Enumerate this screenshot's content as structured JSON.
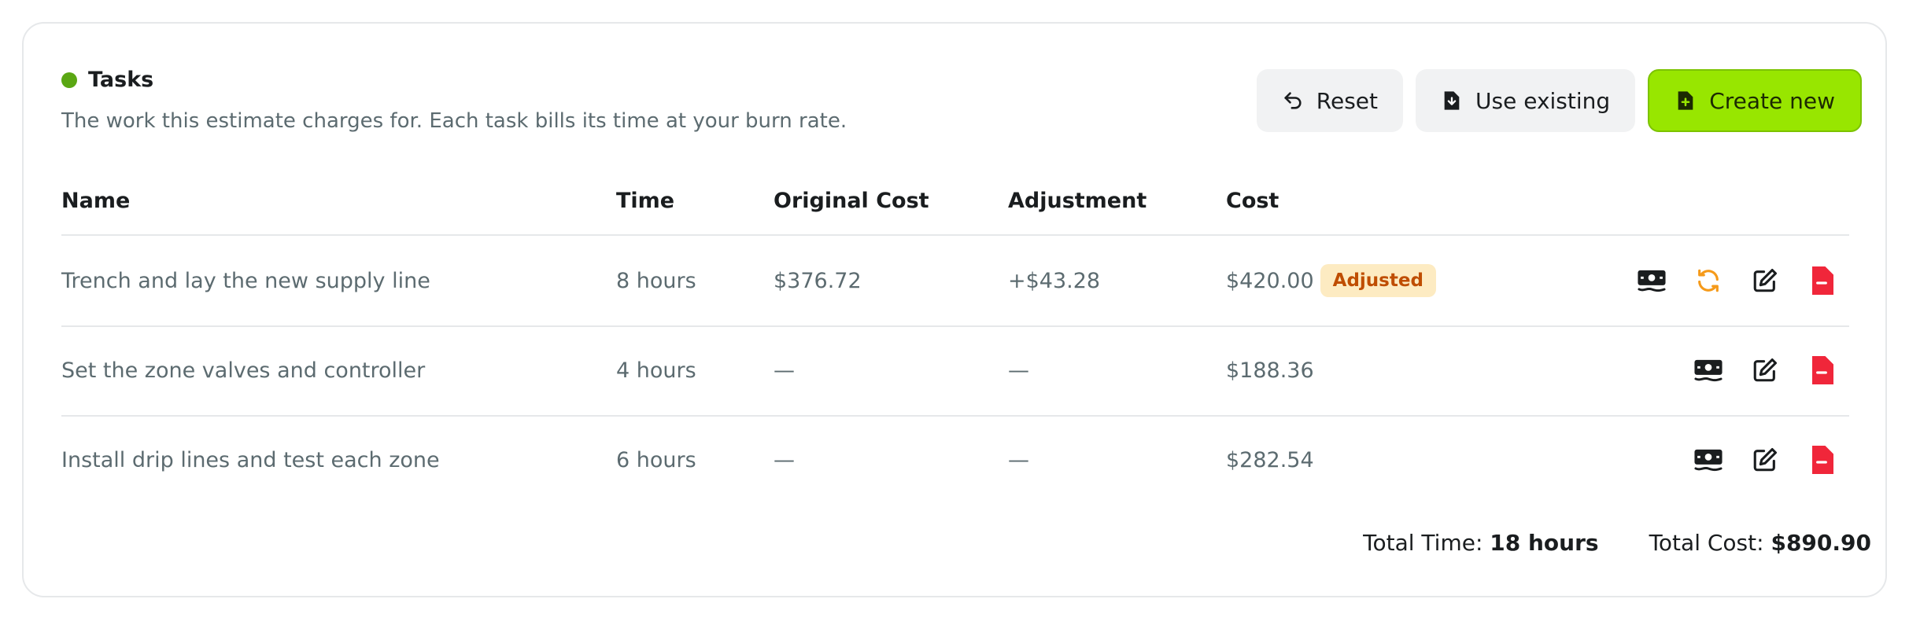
{
  "section": {
    "title": "Tasks",
    "subtitle": "The work this estimate charges for. Each task bills its time at your burn rate.",
    "status_dot_color": "#5aa713"
  },
  "actions": {
    "reset_label": "Reset",
    "use_existing_label": "Use existing",
    "create_new_label": "Create new",
    "accent_color": "#98e600"
  },
  "table": {
    "headers": {
      "name": "Name",
      "time": "Time",
      "original_cost": "Original Cost",
      "adjustment": "Adjustment",
      "cost": "Cost"
    },
    "rows": [
      {
        "name": "Trench and lay the new supply line",
        "time": "8 hours",
        "original_cost": "$376.72",
        "adjustment": "+$43.28",
        "cost": "$420.00",
        "badge": "Adjusted",
        "icons": [
          "money-icon",
          "refresh-icon",
          "edit-icon",
          "delete-icon"
        ]
      },
      {
        "name": "Set the zone valves and controller",
        "time": "4 hours",
        "original_cost": "—",
        "adjustment": "—",
        "cost": "$188.36",
        "icons": [
          "money-icon",
          "edit-icon",
          "delete-icon"
        ]
      },
      {
        "name": "Install drip lines and test each zone",
        "time": "6 hours",
        "original_cost": "—",
        "adjustment": "—",
        "cost": "$282.54",
        "icons": [
          "money-icon",
          "edit-icon",
          "delete-icon"
        ]
      }
    ]
  },
  "totals": {
    "time_label": "Total Time:",
    "time_value": "18 hours",
    "cost_label": "Total Cost:",
    "cost_value": "$890.90"
  },
  "colors": {
    "badge_bg": "#fdebc2",
    "badge_text": "#bf4d00",
    "delete_icon": "#f0263a",
    "refresh_icon": "#f59a1a"
  }
}
